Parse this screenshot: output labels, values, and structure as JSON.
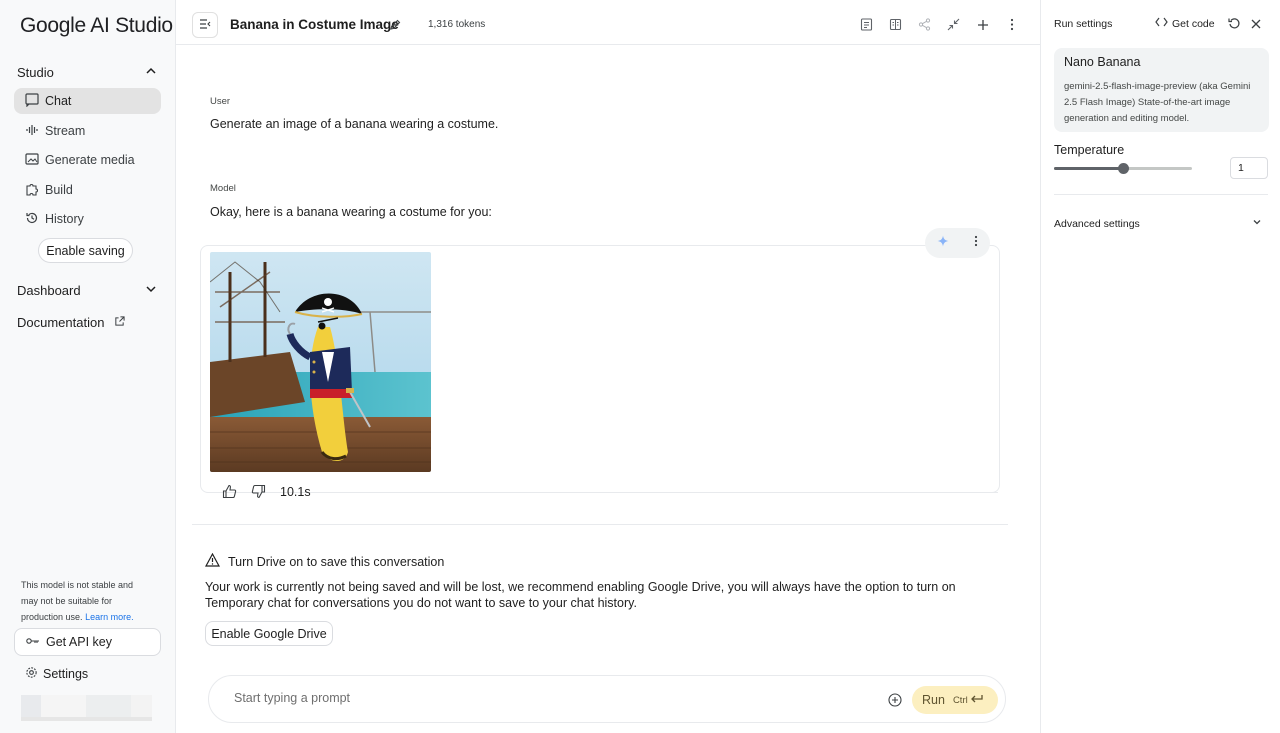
{
  "app": {
    "logo_text": "Google AI Studio"
  },
  "sidebar": {
    "studio_label": "Studio",
    "items": [
      {
        "label": "Chat",
        "icon": "chat-icon",
        "active": true
      },
      {
        "label": "Stream",
        "icon": "waveform-icon"
      },
      {
        "label": "Generate media",
        "icon": "image-icon"
      },
      {
        "label": "Build",
        "icon": "puzzle-icon"
      },
      {
        "label": "History",
        "icon": "history-icon"
      }
    ],
    "enable_saving_label": "Enable saving",
    "dashboard_label": "Dashboard",
    "documentation_label": "Documentation",
    "note_text": "This model is not stable and may not be suitable for production use.",
    "note_link": "Learn more.",
    "api_key_label": "Get API key",
    "settings_label": "Settings"
  },
  "header": {
    "title": "Banana in Costume Image",
    "tokens": "1,316 tokens"
  },
  "conversation": {
    "user_role": "User",
    "user_message": "Generate an image of a banana wearing a costume.",
    "model_role": "Model",
    "model_message": "Okay, here is a banana wearing a costume for you:",
    "timing": "10.1s"
  },
  "drive_notice": {
    "title": "Turn Drive on to save this conversation",
    "body": "Your work is currently not being saved and will be lost, we recommend enabling Google Drive, you will always have the option to turn on Temporary chat for conversations you do not want to save to your chat history.",
    "button_label": "Enable Google Drive"
  },
  "prompt": {
    "placeholder": "Start typing a prompt",
    "run_label": "Run",
    "shortcut": "Ctrl"
  },
  "run_settings": {
    "title": "Run settings",
    "get_code_label": "Get code",
    "model_name": "Nano Banana",
    "model_desc": "gemini-2.5-flash-image-preview (aka Gemini 2.5 Flash Image) State-of-the-art image generation and editing model.",
    "temperature_label": "Temperature",
    "temperature_value": "1",
    "temperature_fraction": 0.5,
    "advanced_label": "Advanced settings"
  },
  "colors": {
    "run_button_bg": "#fcefc0",
    "active_nav_bg": "#e3e3e3",
    "link": "#1a73e8"
  }
}
